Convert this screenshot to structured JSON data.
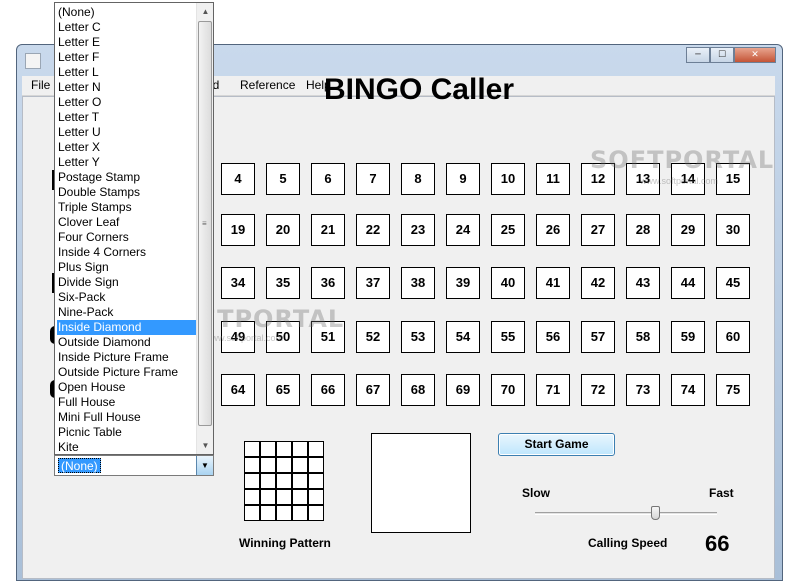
{
  "window": {
    "controls": {
      "minimize": "─",
      "maximize": "☐",
      "close": "✕"
    }
  },
  "menu": {
    "items": [
      {
        "label": "File"
      },
      {
        "label": "nd"
      },
      {
        "label": "Reference"
      },
      {
        "label": "Help"
      }
    ]
  },
  "title": "BINGO Caller",
  "board": {
    "rows": [
      [
        "4",
        "5",
        "6",
        "7",
        "8",
        "9",
        "10",
        "11",
        "12",
        "13",
        "14",
        "15"
      ],
      [
        "19",
        "20",
        "21",
        "22",
        "23",
        "24",
        "25",
        "26",
        "27",
        "28",
        "29",
        "30"
      ],
      [
        "34",
        "35",
        "36",
        "37",
        "38",
        "39",
        "40",
        "41",
        "42",
        "43",
        "44",
        "45"
      ],
      [
        "49",
        "50",
        "51",
        "52",
        "53",
        "54",
        "55",
        "56",
        "57",
        "58",
        "59",
        "60"
      ],
      [
        "64",
        "65",
        "66",
        "67",
        "68",
        "69",
        "70",
        "71",
        "72",
        "73",
        "74",
        "75"
      ]
    ]
  },
  "pattern": {
    "label": "Winning Pattern",
    "dropdown_items": [
      "(None)",
      "Letter C",
      "Letter E",
      "Letter F",
      "Letter L",
      "Letter N",
      "Letter O",
      "Letter T",
      "Letter U",
      "Letter X",
      "Letter Y",
      "Postage Stamp",
      "Double Stamps",
      "Triple Stamps",
      "Clover Leaf",
      "Four Corners",
      "Inside 4 Corners",
      "Plus Sign",
      "Divide Sign",
      "Six-Pack",
      "Nine-Pack",
      "Inside Diamond",
      "Outside Diamond",
      "Inside Picture Frame",
      "Outside Picture Frame",
      "Open House",
      "Full House",
      "Mini Full House",
      "Picnic Table",
      "Kite"
    ],
    "highlighted_item": "Inside Diamond",
    "selected_value": "(None)"
  },
  "controls": {
    "start_button": "Start Game",
    "slow_label": "Slow",
    "fast_label": "Fast",
    "speed_label": "Calling Speed",
    "speed_value": "66",
    "speed_fraction": 0.66
  },
  "watermarks": {
    "brand": "SOFTPORTAL",
    "url": "www.softportal.com"
  },
  "colors": {
    "selection": "#3399ff",
    "button_border": "#3c7fb1"
  }
}
